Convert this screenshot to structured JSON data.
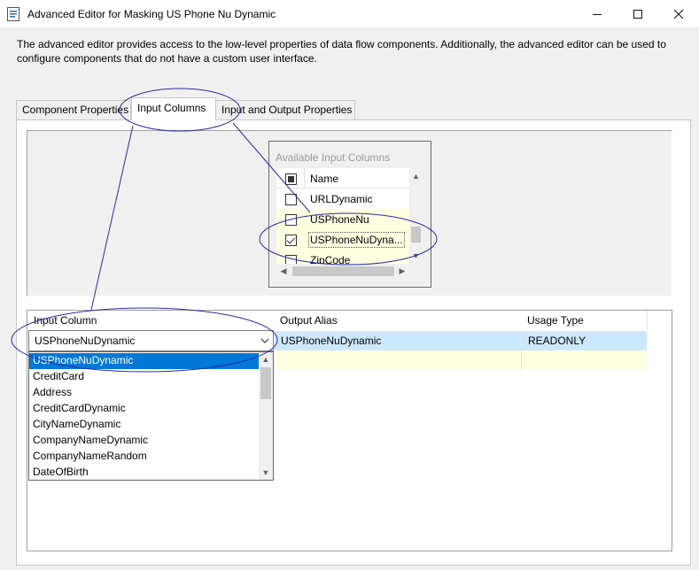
{
  "window": {
    "title": "Advanced Editor for Masking US Phone Nu Dynamic",
    "minimize_glyph": "—",
    "maximize_glyph": "☐",
    "close_glyph": "✕"
  },
  "description": "The advanced editor provides access to the low-level properties of data flow components. Additionally, the advanced editor can be used to configure components that do not have a custom user interface.",
  "tabs": [
    {
      "label": "Component Properties",
      "active": false
    },
    {
      "label": "Input Columns",
      "active": true
    },
    {
      "label": "Input and Output Properties",
      "active": false
    }
  ],
  "available_columns": {
    "title": "Available Input Columns",
    "header": "Name",
    "rows": [
      {
        "label": "URLDynamic",
        "checked": false
      },
      {
        "label": "USPhoneNu",
        "checked": false
      },
      {
        "label": "USPhoneNuDyna...",
        "checked": true
      },
      {
        "label": "ZipCode",
        "checked": false
      }
    ]
  },
  "grid": {
    "columns": [
      "Input Column",
      "Output Alias",
      "Usage Type"
    ],
    "rows": [
      {
        "input_column": "USPhoneNuDynamic",
        "output_alias": "USPhoneNuDynamic",
        "usage_type": "READONLY"
      }
    ]
  },
  "dropdown": {
    "value": "USPhoneNuDynamic",
    "options": [
      "USPhoneNuDynamic",
      "CreditCard",
      "Address",
      "CreditCardDynamic",
      "CityNameDynamic",
      "CompanyNameDynamic",
      "CompanyNameRandom",
      "DateOfBirth"
    ],
    "selected_index": 0
  },
  "icons": {
    "combo_chevron": "⌵",
    "scroll_up": "▲",
    "scroll_down": "▼",
    "scroll_left": "◀",
    "scroll_right": "▶"
  },
  "colors": {
    "selection": "#0078d7",
    "row_highlight": "#cce8ff",
    "new_row": "#ffffe1",
    "annotation": "#2222aa"
  }
}
